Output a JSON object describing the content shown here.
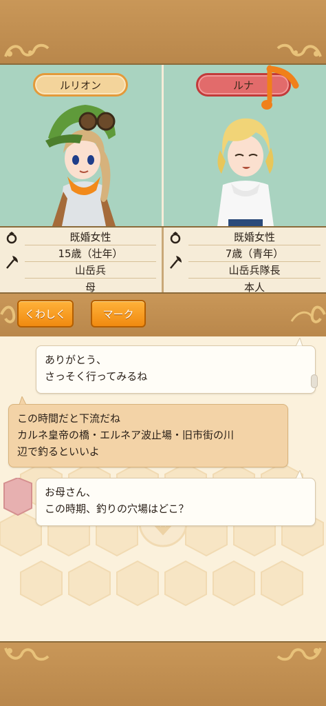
{
  "characters": {
    "left": {
      "name": "ルリオン",
      "status": "既婚女性",
      "age": "15歳（壮年）",
      "job": "山岳兵",
      "relation": "母"
    },
    "right": {
      "name": "ルナ",
      "status": "既婚女性",
      "age": "7歳（青年）",
      "job": "山岳兵隊長",
      "relation": "本人"
    }
  },
  "icons": {
    "ring": "ring-icon",
    "job": "axe-icon",
    "note": "music-note-icon"
  },
  "buttons": {
    "detail_label": "くわしく",
    "mark_label": "マーク"
  },
  "chat": {
    "messages": [
      {
        "side": "right",
        "line1": "ありがとう、",
        "line2": "さっそく行ってみるね"
      },
      {
        "side": "left",
        "line1": "この時間だと下流だね",
        "line2": "カルネ皇帝の橋・エルネア波止場・旧市街の川",
        "line3": "辺で釣るといいよ"
      },
      {
        "side": "right",
        "line1": "お母さん、",
        "line2": "この時期、釣りの穴場はどこ？"
      }
    ]
  },
  "colors": {
    "frame_brown": "#c99758",
    "portrait_bg": "#a9d3c0",
    "button_orange": "#f08a10",
    "name_left": "#f3d49b",
    "name_right": "#e26b6b"
  }
}
